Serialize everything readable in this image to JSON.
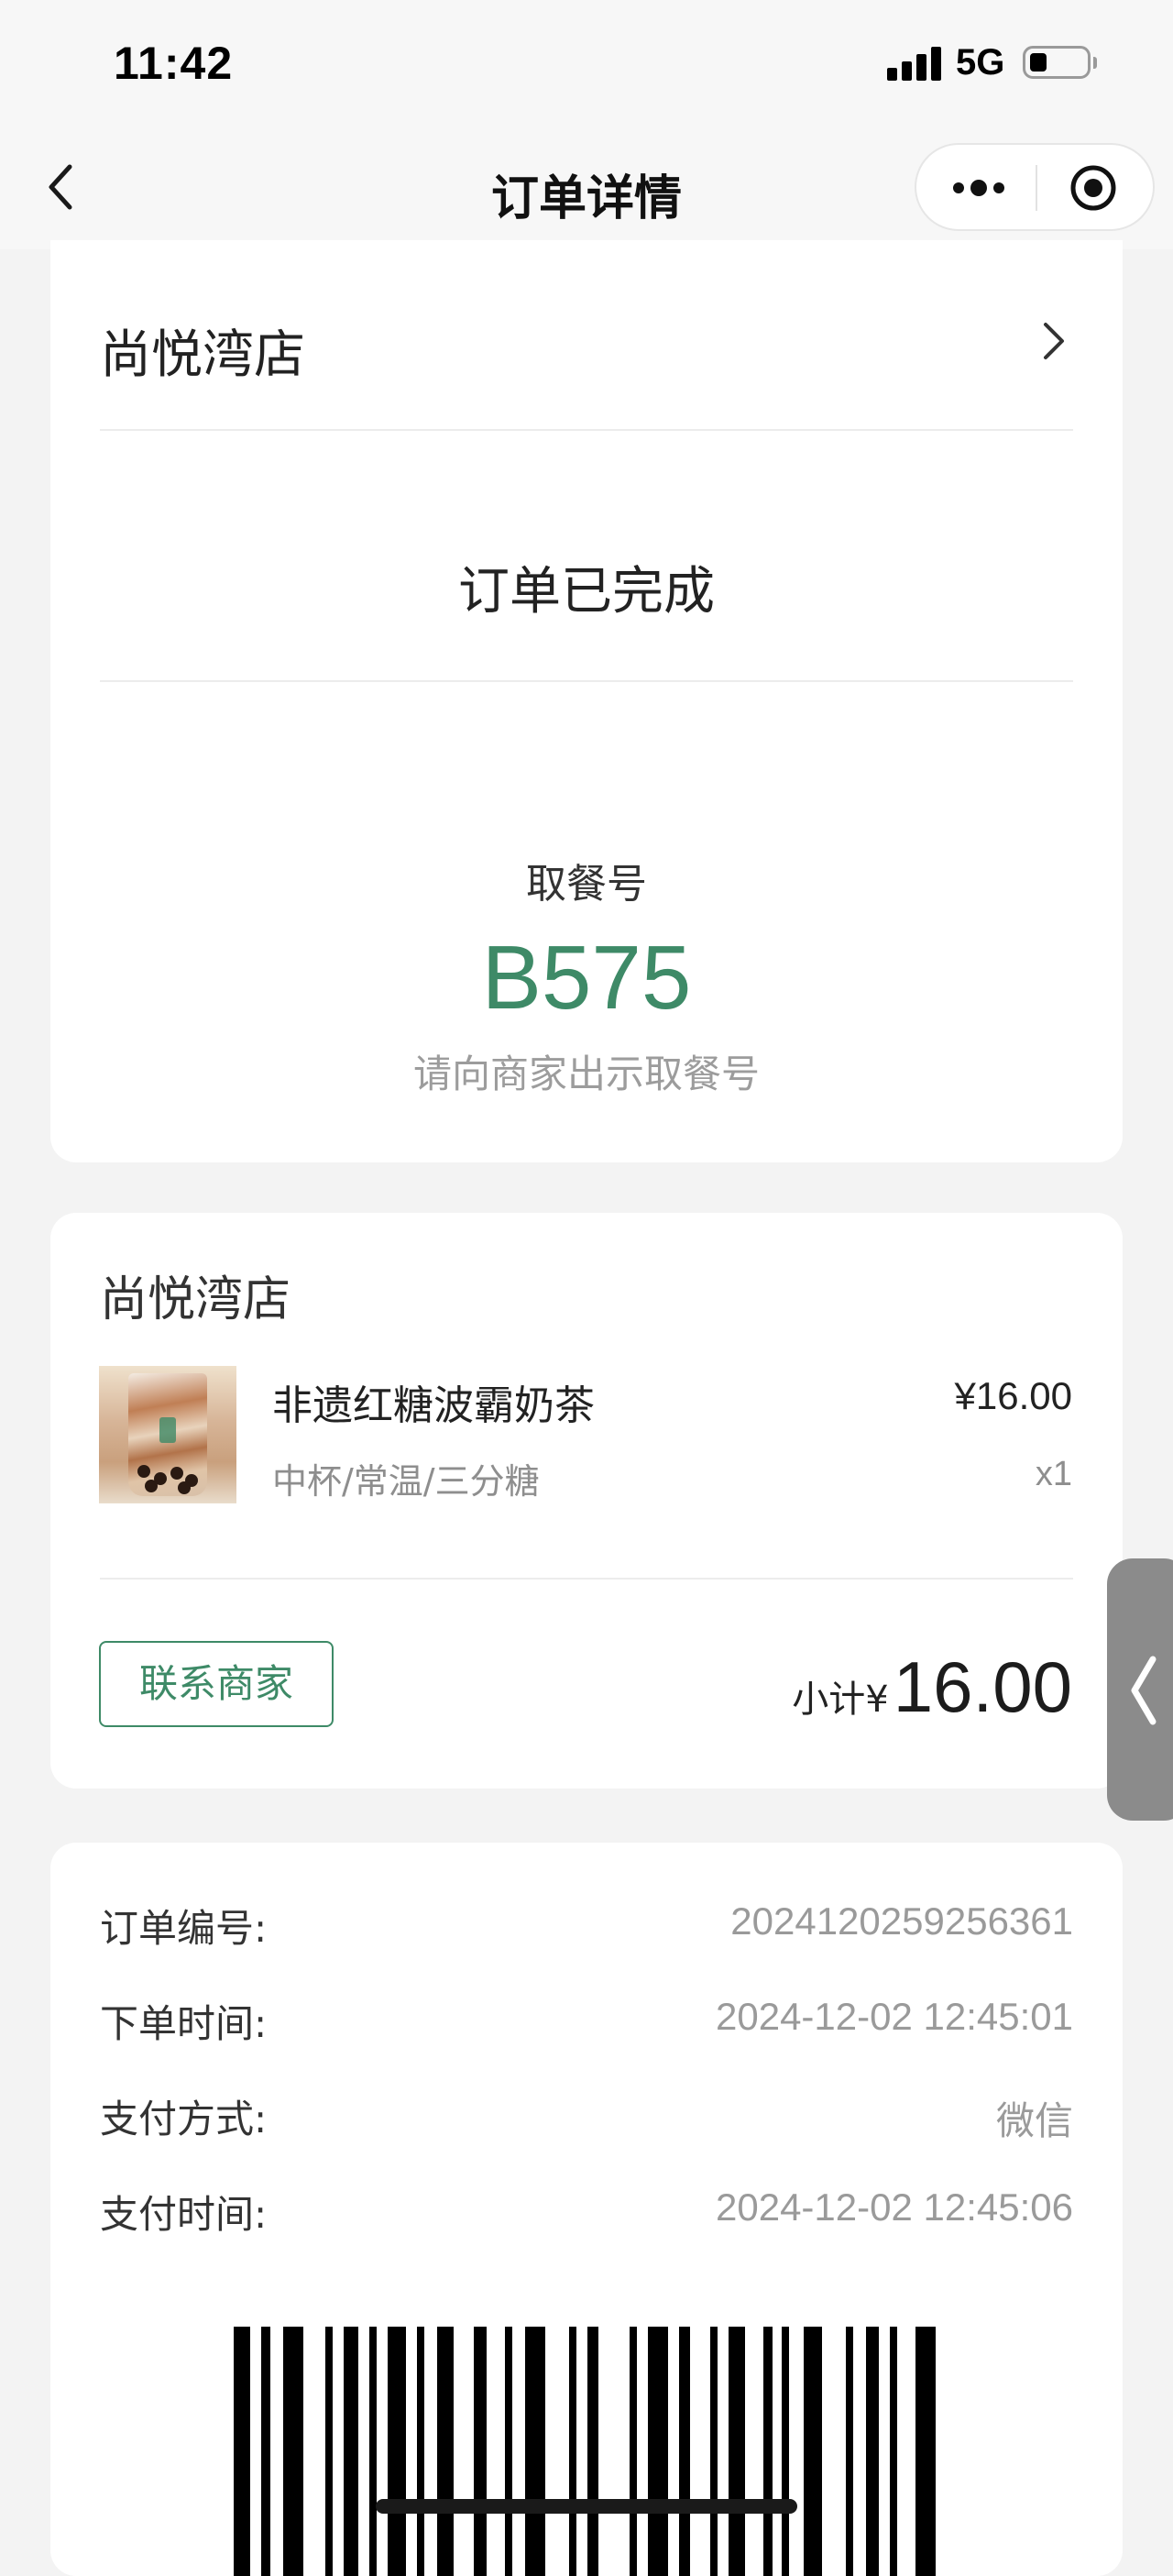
{
  "status_bar": {
    "time": "11:42",
    "network": "5G"
  },
  "nav": {
    "title": "订单详情",
    "back_icon": "chevron-left-icon",
    "more_icon": "more-dots-icon",
    "close_icon": "target-circle-icon"
  },
  "order_card": {
    "store_name": "尚悦湾店",
    "status": "订单已完成",
    "pickup_label": "取餐号",
    "pickup_number": "B575",
    "pickup_hint": "请向商家出示取餐号",
    "accent_color": "#3e8a67"
  },
  "items_card": {
    "store_name": "尚悦湾店",
    "items": [
      {
        "name": "非遗红糖波霸奶茶",
        "options": "中杯/常温/三分糖",
        "price": "¥16.00",
        "quantity": "x1"
      }
    ],
    "contact_button": "联系商家",
    "subtotal_label": "小计¥",
    "subtotal_value": "16.00"
  },
  "info_card": {
    "rows": [
      {
        "label": "订单编号:",
        "value": "2024120259256361"
      },
      {
        "label": "下单时间:",
        "value": "2024-12-02 12:45:01"
      },
      {
        "label": "支付方式:",
        "value": "微信"
      },
      {
        "label": "支付时间:",
        "value": "2024-12-02 12:45:06"
      }
    ]
  }
}
